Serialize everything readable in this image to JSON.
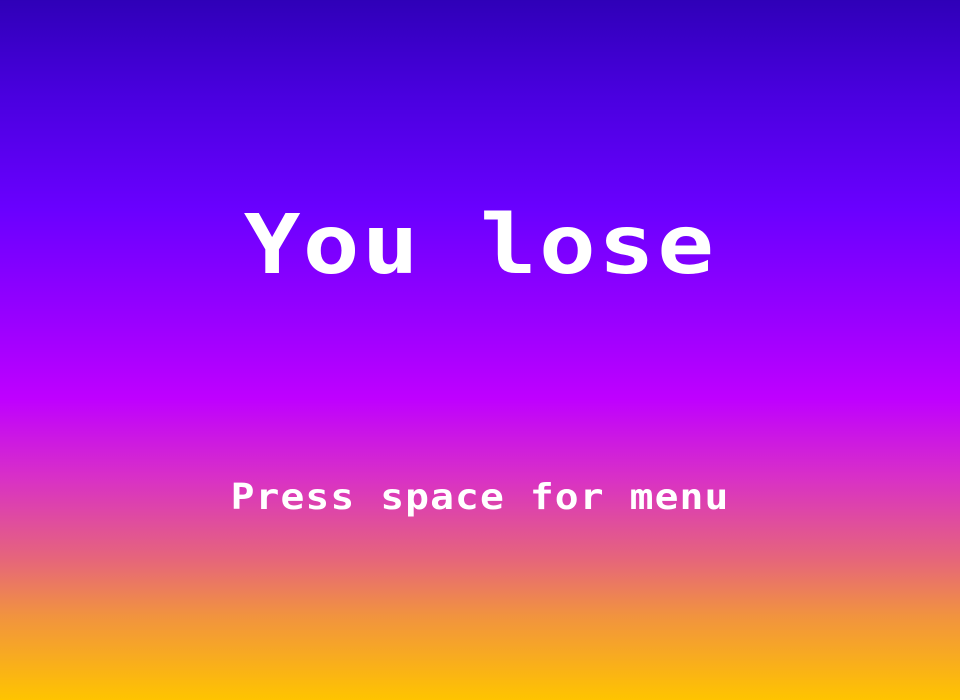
{
  "game_over": {
    "title": "You lose",
    "prompt": "Press space for menu"
  },
  "colors": {
    "gradient_top": "#2f00b8",
    "gradient_mid": "#bf00ff",
    "gradient_bottom": "#ffc400",
    "text": "#ffffff"
  }
}
